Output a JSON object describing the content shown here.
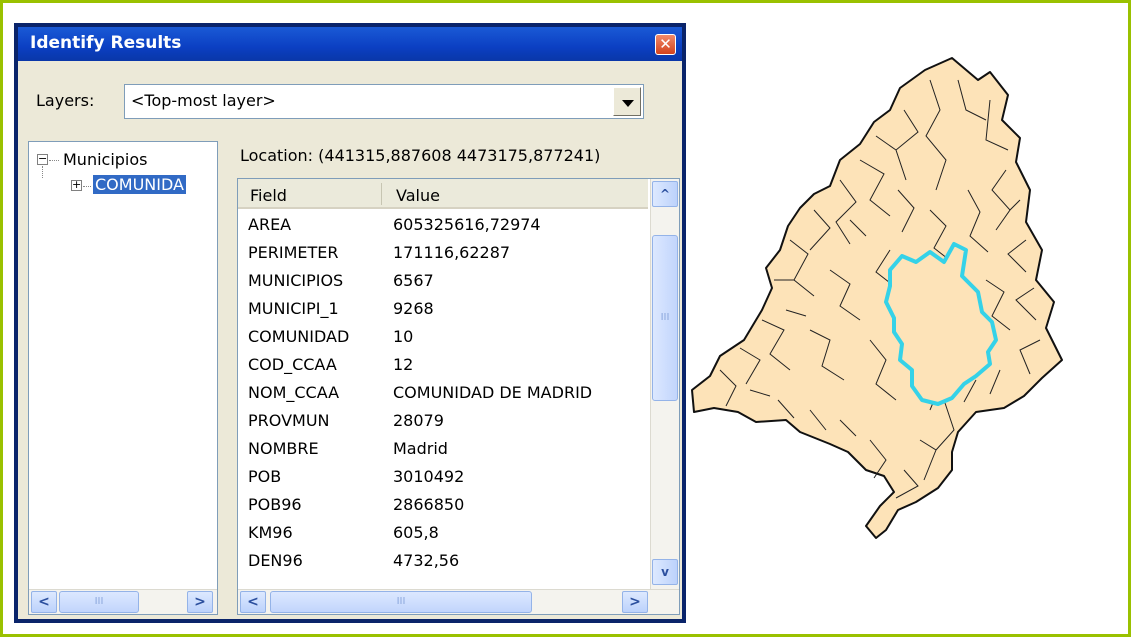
{
  "window": {
    "title": "Identify Results",
    "close_glyph": "✕"
  },
  "layers": {
    "label": "Layers:",
    "selected": "<Top-most layer>"
  },
  "tree": {
    "root": "Municipios",
    "child": "COMUNIDA",
    "collapse_glyph": "−",
    "expand_glyph": "+"
  },
  "location": "Location: (441315,887608 4473175,877241)",
  "grid": {
    "headers": {
      "field": "Field",
      "value": "Value"
    },
    "rows": [
      {
        "field": "AREA",
        "value": "605325616,72974"
      },
      {
        "field": "PERIMETER",
        "value": "171116,62287"
      },
      {
        "field": "MUNICIPIOS",
        "value": "6567"
      },
      {
        "field": "MUNICIPI_1",
        "value": "9268"
      },
      {
        "field": "COMUNIDAD",
        "value": "10"
      },
      {
        "field": "COD_CCAA",
        "value": "12"
      },
      {
        "field": "NOM_CCAA",
        "value": "COMUNIDAD DE MADRID"
      },
      {
        "field": "PROVMUN",
        "value": "28079"
      },
      {
        "field": "NOMBRE",
        "value": "Madrid"
      },
      {
        "field": "POB",
        "value": "3010492"
      },
      {
        "field": "POB96",
        "value": "2866850"
      },
      {
        "field": "KM96",
        "value": "605,8"
      },
      {
        "field": "DEN96",
        "value": "4732,56"
      }
    ]
  },
  "scroll": {
    "left": "<",
    "right": ">",
    "up": "^",
    "down": "v",
    "grip": "III"
  },
  "icons": [
    "close-icon",
    "dropdown-arrow-icon",
    "scroll-left-icon",
    "scroll-right-icon",
    "scroll-up-icon",
    "scroll-down-icon"
  ],
  "colors": {
    "title_bar": "#0b3fc2",
    "selection": "#316ac5",
    "map_fill": "#fde3b8",
    "map_highlight": "#35d2e8",
    "frame": "#9ac100"
  }
}
